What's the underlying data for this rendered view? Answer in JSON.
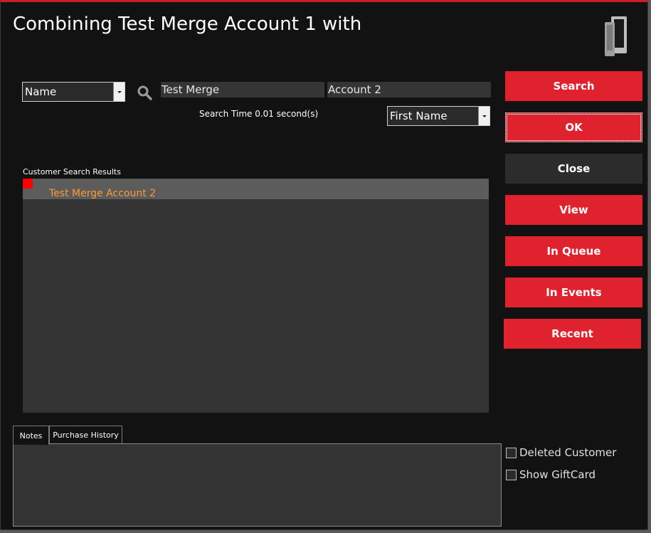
{
  "window": {
    "title": "Combining Test Merge Account 1 with"
  },
  "search": {
    "field_select": "Name",
    "first_input_value": "Test Merge",
    "second_input_value": "Account 2",
    "order_select": "First Name",
    "search_time_text": "Search Time 0.01 second(s)"
  },
  "results": {
    "label": "Customer Search Results",
    "rows": [
      {
        "name": "Test Merge Account 2"
      }
    ]
  },
  "buttons": {
    "search": "Search",
    "ok": "OK",
    "close": "Close",
    "view": "View",
    "in_queue": "In Queue",
    "in_events": "In Events",
    "recent": "Recent"
  },
  "tabs": {
    "notes": "Notes",
    "purchase_history": "Purchase History"
  },
  "options": {
    "deleted_customer": "Deleted Customer",
    "show_giftcard": "Show GiftCard"
  },
  "icons": {
    "app": "phone-device-icon",
    "search": "search-icon"
  },
  "colors": {
    "accent": "#e0222e",
    "result_text": "#ff9933",
    "background": "#121212"
  }
}
